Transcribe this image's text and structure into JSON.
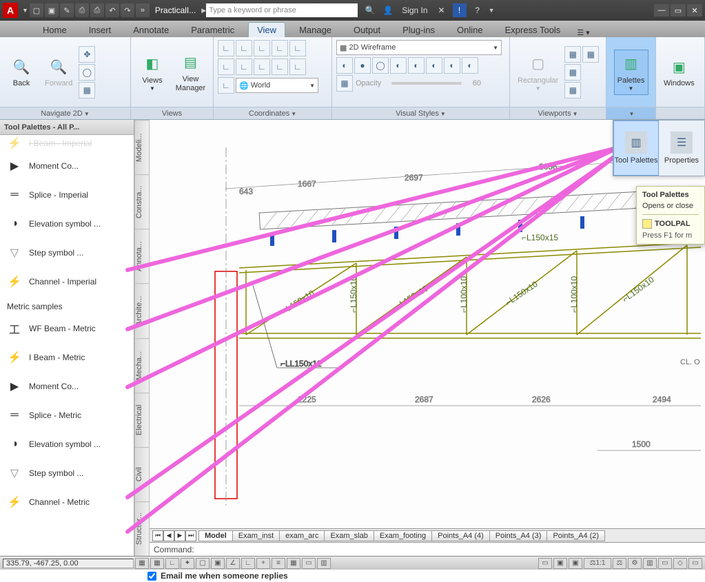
{
  "titlebar": {
    "doc_title": "PracticalI...",
    "search_placeholder": "Type a keyword or phrase",
    "sign_in": "Sign In"
  },
  "ribbon_tabs": [
    "Home",
    "Insert",
    "Annotate",
    "Parametric",
    "View",
    "Manage",
    "Output",
    "Plug-ins",
    "Online",
    "Express Tools"
  ],
  "active_tab": "View",
  "panels": {
    "navigate": {
      "title": "Navigate 2D",
      "back": "Back",
      "forward": "Forward"
    },
    "views": {
      "title": "Views",
      "views": "Views",
      "view_manager": "View\nManager"
    },
    "coordinates": {
      "title": "Coordinates",
      "world": "World"
    },
    "visual_styles": {
      "title": "Visual Styles",
      "wireframe": "2D Wireframe",
      "opacity_label": "Opacity",
      "opacity_value": "60"
    },
    "viewports": {
      "title": "Viewports",
      "rectangular": "Rectangular"
    },
    "palettes": {
      "title": "Palettes",
      "label": "Palettes"
    },
    "windows": {
      "title": "",
      "label": "Windows"
    }
  },
  "palettes_dropdown": {
    "tool_palettes": "Tool Palettes",
    "properties": "Properties"
  },
  "tooltip": {
    "title": "Tool Palettes",
    "body": "Opens or close",
    "cmd": "TOOLPAL",
    "f1": "Press F1 for m"
  },
  "tool_palette": {
    "header": "Tool Palettes - All P...",
    "group_metric": "Metric samples",
    "items_top": [
      "I Beam - Imperial",
      "Moment Co...",
      "Splice - Imperial",
      "Elevation symbol ...",
      "Step symbol ...",
      "Channel - Imperial"
    ],
    "items_metric": [
      "WF Beam - Metric",
      "I Beam - Metric",
      "Moment Co...",
      "Splice - Metric",
      "Elevation symbol ...",
      "Step symbol ...",
      "Channel - Metric"
    ]
  },
  "side_tabs": [
    "Modeli...",
    "Constra...",
    "Annota...",
    "Archite...",
    "Mecha...",
    "Electrical",
    "Civil",
    "Structur..."
  ],
  "drawing": {
    "dims_top": [
      "643",
      "1667",
      "2697",
      "2636"
    ],
    "dims_bot": [
      "2225",
      "2687",
      "2626",
      "2494"
    ],
    "dim_right": "1500",
    "member_top": "⌐L150x15",
    "members": [
      "⌐L150x10",
      "⌐L150x10",
      "⌐L150x10",
      "⌐L100x10",
      "⌐L150x10",
      "⌐L100x10",
      "⌐L150x10"
    ],
    "leader": "⌐LL150x12",
    "note_right": "CL. O"
  },
  "layout_tabs": [
    "Model",
    "Exam_inst",
    "exam_arc",
    "Exam_slab",
    "Exam_footing",
    "Points_A4 (4)",
    "Points_A4 (3)",
    "Points_A4 (2)"
  ],
  "command": "Command:",
  "status": {
    "coords": "335.79, -467.25, 0.00",
    "scale": "1:1"
  },
  "email_label": "Email me when someone replies"
}
